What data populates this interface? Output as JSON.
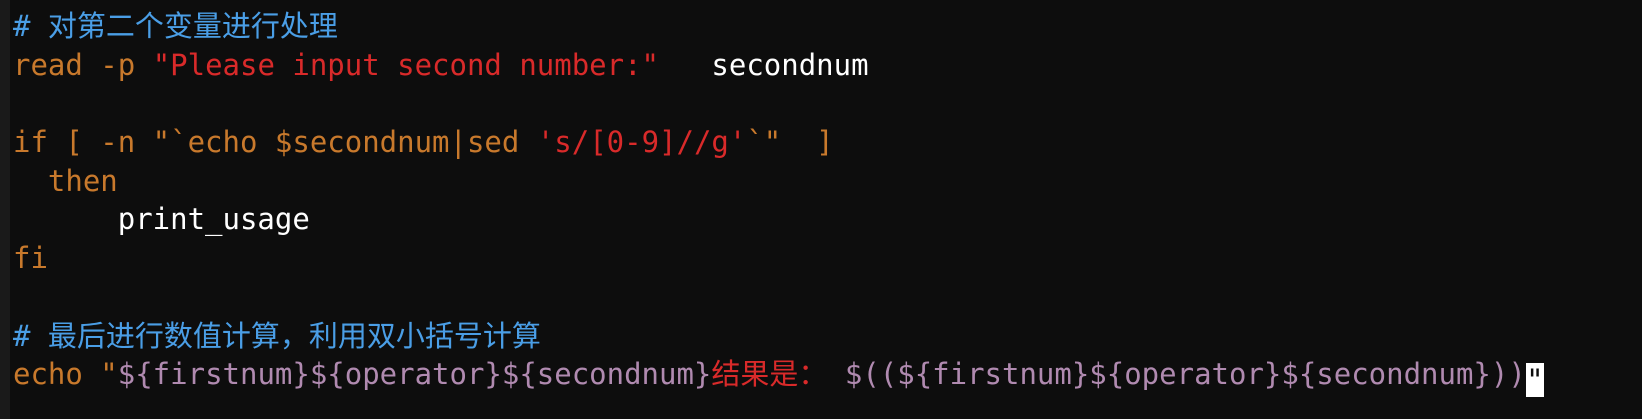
{
  "colors": {
    "background": "#0d0d0d",
    "default": "#ffffff",
    "comment": "#4a9ee6",
    "keyword": "#c8792c",
    "string": "#d92a2a",
    "variable": "#b08ab0",
    "cursor": "#ffffff"
  },
  "lines": [
    [
      {
        "text": "# 对第二个变量进行处理",
        "kind": "comment"
      }
    ],
    [
      {
        "text": "read -p ",
        "kind": "keyword"
      },
      {
        "text": "\"Please input second number:\"",
        "kind": "string"
      },
      {
        "text": "   secondnum",
        "kind": "default"
      }
    ],
    [],
    [
      {
        "text": "if [ -n \"`echo ",
        "kind": "keyword"
      },
      {
        "text": "$secondnum",
        "kind": "keyword"
      },
      {
        "text": "|sed ",
        "kind": "keyword"
      },
      {
        "text": "'s/[0-9]//g'",
        "kind": "string"
      },
      {
        "text": "`\"  ]",
        "kind": "keyword"
      }
    ],
    [
      {
        "text": "  then",
        "kind": "keyword"
      }
    ],
    [
      {
        "text": "      print_usage",
        "kind": "default"
      }
    ],
    [
      {
        "text": "fi",
        "kind": "keyword"
      }
    ],
    [],
    [
      {
        "text": "# 最后进行数值计算，利用双小括号计算",
        "kind": "comment"
      }
    ],
    [
      {
        "text": "echo \"",
        "kind": "keyword"
      },
      {
        "text": "${firstnum}${operator}${secondnum}",
        "kind": "variable"
      },
      {
        "text": "结果是：",
        "kind": "string"
      },
      {
        "text": " ",
        "kind": "default"
      },
      {
        "text": "$((${firstnum}${operator}${secondnum}))",
        "kind": "variable"
      }
    ]
  ],
  "cursor": {
    "text": "\""
  }
}
